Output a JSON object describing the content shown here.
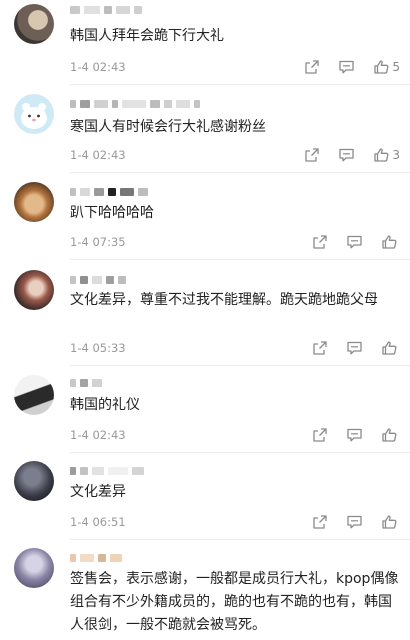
{
  "comments": [
    {
      "text": "韩国人拜年会跪下行大礼",
      "time": "1-4 02:43",
      "likes": "5"
    },
    {
      "text": "寒国人有时候会行大礼感谢粉丝",
      "time": "1-4 02:43",
      "likes": "3"
    },
    {
      "text": "趴下哈哈哈哈",
      "time": "1-4 07:35",
      "likes": ""
    },
    {
      "text": "文化差异，尊重不过我不能理解。跪天跪地跪父母",
      "time": "1-4 05:33",
      "likes": ""
    },
    {
      "text": "韩国的礼仪",
      "time": "1-4 02:43",
      "likes": ""
    },
    {
      "text": "文化差异",
      "time": "1-4 06:51",
      "likes": ""
    },
    {
      "text": "签售会，表示感谢，一般都是成员行大礼，kpop偶像组合有不少外籍成员的，跪的也有不跪的也有，韩国人很剑，一般不跪就会被骂死。",
      "time": "",
      "likes": ""
    }
  ],
  "icons": {
    "share": "share-icon",
    "comment": "comment-icon",
    "like": "thumbs-up-icon"
  },
  "colors": {
    "text": "#222222",
    "meta": "#9a9a9a",
    "icon": "#8a8a8a",
    "divider": "#ececec"
  }
}
